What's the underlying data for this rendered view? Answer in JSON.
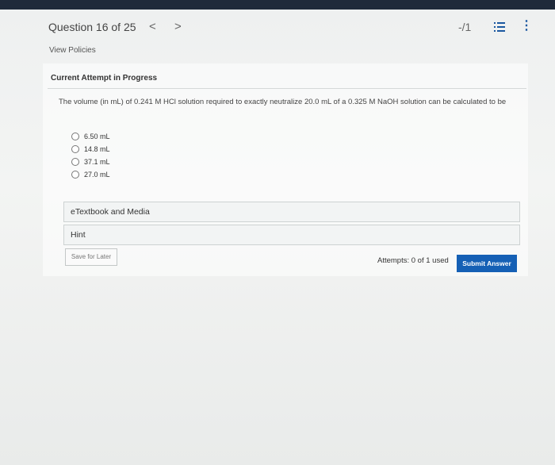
{
  "header": {
    "question_counter": "Question 16 of 25",
    "prev_glyph": "<",
    "next_glyph": ">",
    "score": "-/1",
    "more_glyph": "⋮"
  },
  "view_policies": "View Policies",
  "attempt_heading": "Current Attempt in Progress",
  "question": {
    "text": "The volume (in mL) of 0.241 M HCl solution required to exactly neutralize 20.0 mL of a 0.325 M NaOH solution can be calculated to be",
    "options": [
      "6.50 mL",
      "14.8 mL",
      "37.1 mL",
      "27.0 mL"
    ]
  },
  "panels": {
    "etextbook": "eTextbook and Media",
    "hint": "Hint"
  },
  "footer": {
    "save_label": "Save for Later",
    "attempts": "Attempts: 0 of 1 used",
    "submit_label": "Submit Answer"
  },
  "colors": {
    "accent": "#1560b5",
    "topbar": "#1f2a3a"
  }
}
